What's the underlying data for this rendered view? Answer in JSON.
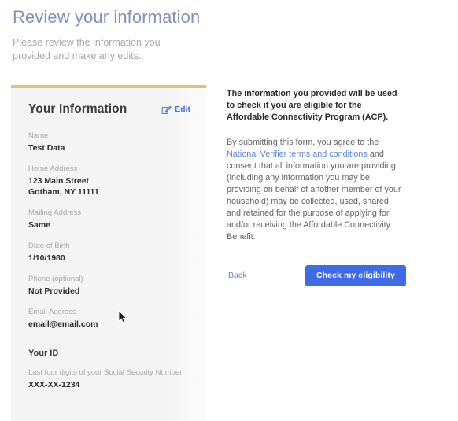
{
  "header": {
    "title": "Review your information",
    "subtitle": "Please review the information you provided and make any edits."
  },
  "colors": {
    "card_accent": "#cdcd6d",
    "primary_button": "#3f6ae8",
    "link": "#5b86dd",
    "title": "#8190bd"
  },
  "info_card": {
    "title": "Your Information",
    "edit_label": "Edit",
    "edit_icon": "pencil-square-icon",
    "fields": [
      {
        "label": "Name",
        "value": "Test Data"
      },
      {
        "label": "Home Address",
        "value": "123 Main Street",
        "value2": "Gotham, NY 11111"
      },
      {
        "label": "Mailing Address",
        "value": "Same"
      },
      {
        "label": "Date of Birth",
        "value": "1/10/1980"
      },
      {
        "label": "Phone (optional)",
        "value": "Not Provided"
      },
      {
        "label": "Email Address",
        "value": "email@email.com"
      }
    ],
    "id_section": {
      "heading": "Your ID",
      "label": "Last four digits of your Social Security Number",
      "value": "XXX-XX-1234"
    }
  },
  "detail": {
    "lead": "The information you provided will be used to check if you are eligible for the Affordable Connectivity Program (ACP).",
    "consent_part1": "By submitting this form, you agree to the ",
    "consent_link": "National Verifier terms and conditions",
    "consent_part2": " and consent that all information you are providing (including any information you may be providing on behalf of another member of your household) may be collected, used, shared, and retained for the purpose of applying for and/or receiving the Affordable Connectivity Benefit.",
    "back_label": "Back",
    "submit_label": "Check my eligibility"
  }
}
